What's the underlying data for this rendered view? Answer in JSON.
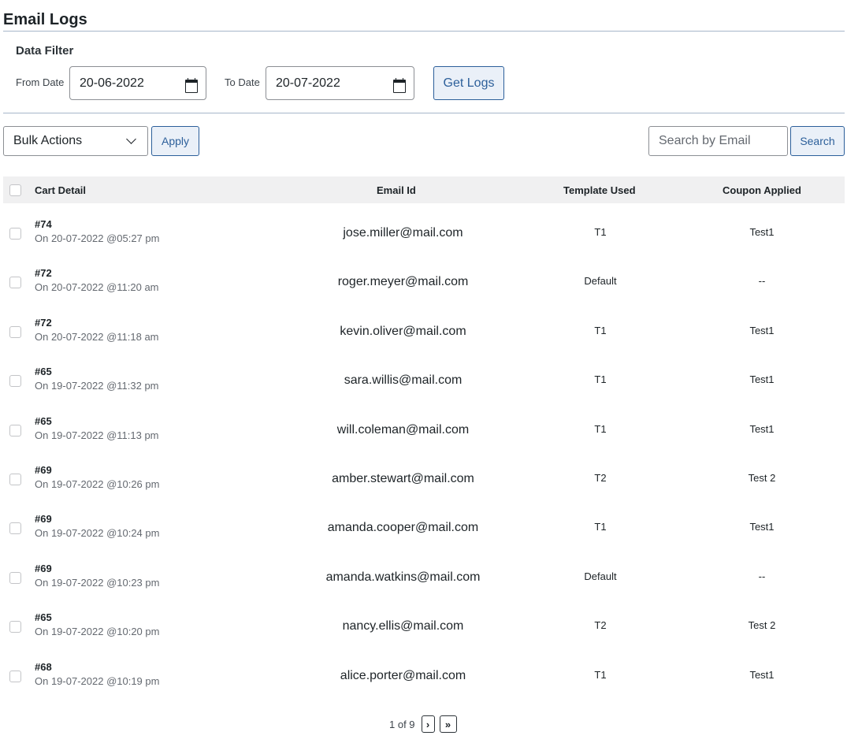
{
  "page": {
    "title": "Email Logs"
  },
  "filter": {
    "title": "Data Filter",
    "from_label": "From Date",
    "from_value": "20-06-2022",
    "to_label": "To Date",
    "to_value": "20-07-2022",
    "get_logs_label": "Get Logs"
  },
  "toolbar": {
    "bulk_actions": "Bulk Actions",
    "apply_label": "Apply",
    "search_placeholder": "Search by Email",
    "search_label": "Search"
  },
  "table": {
    "headers": {
      "cart": "Cart Detail",
      "email": "Email Id",
      "template": "Template Used",
      "coupon": "Coupon Applied"
    },
    "rows": [
      {
        "cart_id": "#74",
        "date": "On 20-07-2022 @05:27 pm",
        "email": "jose.miller@mail.com",
        "template": "T1",
        "coupon": "Test1"
      },
      {
        "cart_id": "#72",
        "date": "On 20-07-2022 @11:20 am",
        "email": "roger.meyer@mail.com",
        "template": "Default",
        "coupon": "--"
      },
      {
        "cart_id": "#72",
        "date": "On 20-07-2022 @11:18 am",
        "email": "kevin.oliver@mail.com",
        "template": "T1",
        "coupon": "Test1"
      },
      {
        "cart_id": "#65",
        "date": "On 19-07-2022 @11:32 pm",
        "email": "sara.willis@mail.com",
        "template": "T1",
        "coupon": "Test1"
      },
      {
        "cart_id": "#65",
        "date": "On 19-07-2022 @11:13 pm",
        "email": "will.coleman@mail.com",
        "template": "T1",
        "coupon": "Test1"
      },
      {
        "cart_id": "#69",
        "date": "On 19-07-2022 @10:26 pm",
        "email": "amber.stewart@mail.com",
        "template": "T2",
        "coupon": "Test 2"
      },
      {
        "cart_id": "#69",
        "date": "On 19-07-2022 @10:24 pm",
        "email": "amanda.cooper@mail.com",
        "template": "T1",
        "coupon": "Test1"
      },
      {
        "cart_id": "#69",
        "date": "On 19-07-2022 @10:23 pm",
        "email": "amanda.watkins@mail.com",
        "template": "Default",
        "coupon": "--"
      },
      {
        "cart_id": "#65",
        "date": "On 19-07-2022 @10:20 pm",
        "email": "nancy.ellis@mail.com",
        "template": "T2",
        "coupon": "Test 2"
      },
      {
        "cart_id": "#68",
        "date": "On 19-07-2022 @10:19 pm",
        "email": "alice.porter@mail.com",
        "template": "T1",
        "coupon": "Test1"
      }
    ]
  },
  "pagination": {
    "label": "1 of 9",
    "next": "›",
    "last": "»"
  }
}
